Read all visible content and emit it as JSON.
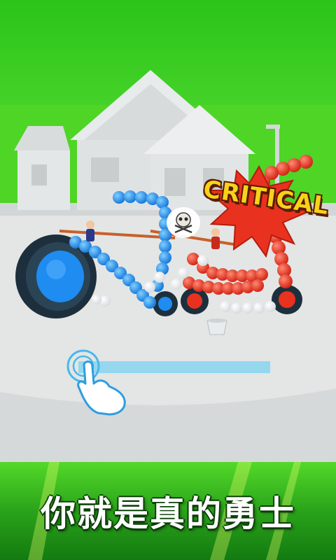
{
  "banner": {
    "text": "你就是真的勇士"
  },
  "effects": {
    "critical_text": "CRITICAL"
  },
  "icons": {
    "skull": "skull-crossbones-icon",
    "tap_hint": "pointing-hand-icon"
  },
  "colors": {
    "sky": "#3ac41e",
    "player_balls": "#1f8df0",
    "enemy_balls": "#e8321f",
    "ground": "#e3e6e4",
    "draw_line": "#8fd6ef",
    "critical_fill": "#f6d21a",
    "starburst": "#e8321f"
  }
}
